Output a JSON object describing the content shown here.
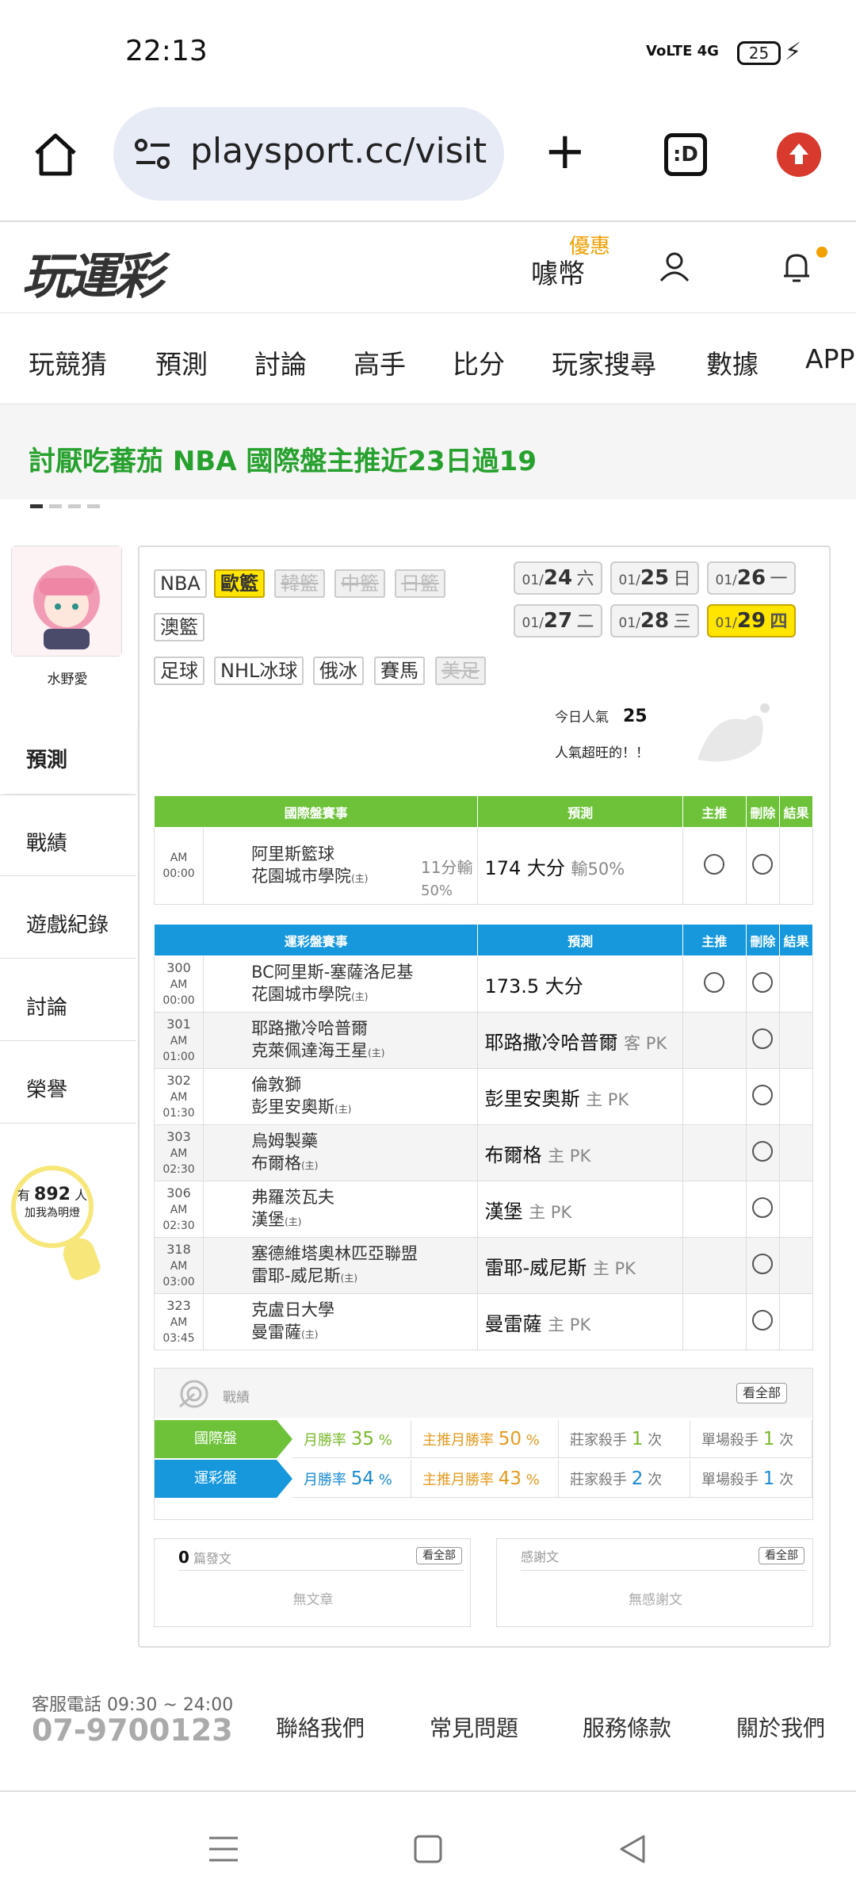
{
  "status": {
    "time": "22:13",
    "signal": "VoLTE 4G",
    "battery": "25"
  },
  "browser": {
    "url": "playsport.cc/visit"
  },
  "site": {
    "logo": "玩運彩",
    "coin_promo": "優惠",
    "coin": "噱幣",
    "nav": [
      "玩競猜",
      "預測",
      "討論",
      "高手",
      "比分",
      "玩家搜尋",
      "數據",
      "APP"
    ],
    "promo": "討厭吃蕃茄 NBA 國際盤主推近23日過19"
  },
  "profile": {
    "name": "水野愛",
    "menu": [
      "預測",
      "戰績",
      "遊戲紀錄",
      "討論",
      "榮譽"
    ],
    "fans_prefix": "有",
    "fans_count": "892",
    "fans_suffix": "人",
    "fans_cta": "加我為明燈"
  },
  "leagues": [
    {
      "label": "NBA",
      "state": "normal"
    },
    {
      "label": "歐籃",
      "state": "selected"
    },
    {
      "label": "韓籃",
      "state": "disabled"
    },
    {
      "label": "中籃",
      "state": "disabled"
    },
    {
      "label": "日籃",
      "state": "disabled"
    },
    {
      "label": "澳籃",
      "state": "normal"
    },
    {
      "label": "足球",
      "state": "normal"
    },
    {
      "label": "NHL冰球",
      "state": "normal"
    },
    {
      "label": "俄冰",
      "state": "normal"
    },
    {
      "label": "賽馬",
      "state": "normal"
    },
    {
      "label": "美足",
      "state": "disabled"
    }
  ],
  "dates": [
    {
      "md": "01/",
      "day": "24",
      "wd": "六"
    },
    {
      "md": "01/",
      "day": "25",
      "wd": "日"
    },
    {
      "md": "01/",
      "day": "26",
      "wd": "一"
    },
    {
      "md": "01/",
      "day": "27",
      "wd": "二"
    },
    {
      "md": "01/",
      "day": "28",
      "wd": "三"
    },
    {
      "md": "01/",
      "day": "29",
      "wd": "四"
    }
  ],
  "popularity": {
    "label": "今日人氣",
    "value": "25",
    "note": "人氣超旺的！！"
  },
  "intl_table": {
    "headers": [
      "國際盤賽事",
      "預測",
      "主推",
      "刪除",
      "結果"
    ],
    "rows": [
      {
        "num": "",
        "time": "AM 00:00",
        "team1": "阿里斯籃球",
        "team2": "花園城市學院",
        "home": "(主)",
        "line": "11分輸",
        "line2": "50%",
        "pred": "174 大分",
        "pred_note": "輸50%"
      }
    ]
  },
  "sports_table": {
    "headers": [
      "運彩盤賽事",
      "預測",
      "主推",
      "刪除",
      "結果"
    ],
    "rows": [
      {
        "num": "300",
        "time": "AM 00:00",
        "team1": "BC阿里斯-塞薩洛尼基",
        "team2": "花園城市學院",
        "home": "(主)",
        "pred": "173.5 大分",
        "pred_note": ""
      },
      {
        "num": "301",
        "time": "AM 01:00",
        "team1": "耶路撒冷哈普爾",
        "team2": "克萊佩達海王星",
        "home": "(主)",
        "pred": "耶路撒冷哈普爾",
        "pred_note": "客 PK"
      },
      {
        "num": "302",
        "time": "AM 01:30",
        "team1": "倫敦獅",
        "team2": "彭里安奧斯",
        "home": "(主)",
        "pred": "彭里安奧斯",
        "pred_note": "主 PK"
      },
      {
        "num": "303",
        "time": "AM 02:30",
        "team1": "烏姆製藥",
        "team2": "布爾格",
        "home": "(主)",
        "pred": "布爾格",
        "pred_note": "主 PK"
      },
      {
        "num": "306",
        "time": "AM 02:30",
        "team1": "弗羅茨瓦夫",
        "team2": "漢堡",
        "home": "(主)",
        "pred": "漢堡",
        "pred_note": "主 PK"
      },
      {
        "num": "318",
        "time": "AM 03:00",
        "team1": "塞德維塔奧林匹亞聯盟",
        "team2": "雷耶-威尼斯",
        "home": "(主)",
        "pred": "雷耶-威尼斯",
        "pred_note": "主 PK"
      },
      {
        "num": "323",
        "time": "AM 03:45",
        "team1": "克盧日大學",
        "team2": "曼雷薩",
        "home": "(主)",
        "pred": "曼雷薩",
        "pred_note": "主 PK"
      }
    ]
  },
  "stats": {
    "title": "戰績",
    "view_all": "看全部",
    "rows": [
      {
        "label": "國際盤",
        "month_lbl": "月勝率",
        "month": "35",
        "main_lbl": "主推月勝率",
        "main": "50",
        "pct": "%",
        "killer_lbl": "莊家殺手",
        "killer": "1",
        "single_lbl": "單場殺手",
        "single": "1",
        "unit": "次"
      },
      {
        "label": "運彩盤",
        "month_lbl": "月勝率",
        "month": "54",
        "main_lbl": "主推月勝率",
        "main": "43",
        "pct": "%",
        "killer_lbl": "莊家殺手",
        "killer": "2",
        "single_lbl": "單場殺手",
        "single": "1",
        "unit": "次"
      }
    ]
  },
  "posts": {
    "count": "0",
    "label": "篇發文",
    "view_all": "看全部",
    "empty": "無文章"
  },
  "thanks": {
    "label": "感謝文",
    "view_all": "看全部",
    "empty": "無感謝文"
  },
  "footer": {
    "hours": "客服電話 09:30 ~ 24:00",
    "phone": "07-9700123",
    "links": [
      "聯絡我們",
      "常見問題",
      "服務條款",
      "關於我們"
    ]
  }
}
